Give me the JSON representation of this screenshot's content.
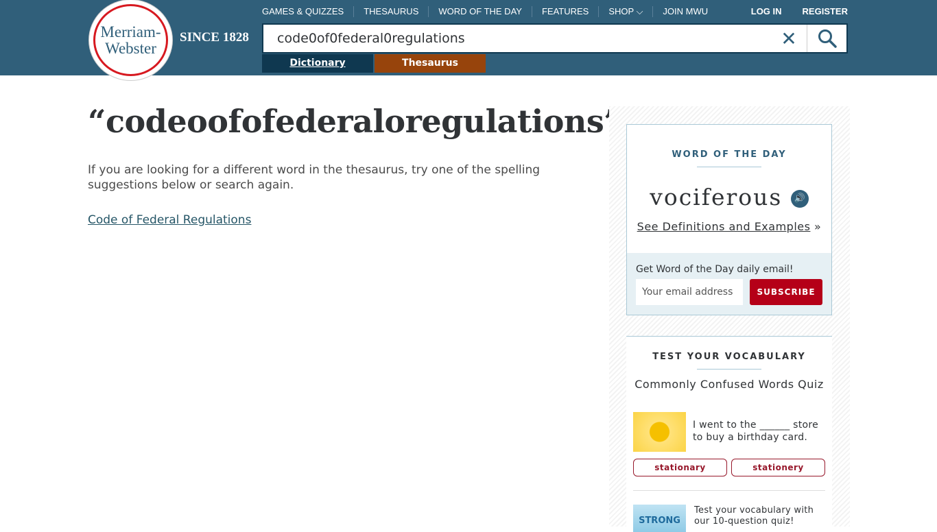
{
  "header": {
    "logo_line1": "Merriam-",
    "logo_line2": "Webster",
    "since": "SINCE 1828",
    "nav": [
      "GAMES & QUIZZES",
      "THESAURUS",
      "WORD OF THE DAY",
      "FEATURES",
      "SHOP ⌵",
      "JOIN MWU"
    ],
    "login": "LOG IN",
    "register": "REGISTER",
    "search_value": "code0of0federal0regulations",
    "tabs": {
      "dictionary": "Dictionary",
      "thesaurus": "Thesaurus"
    }
  },
  "main": {
    "title": "“codeoofofederaloregulations”",
    "message": "If you are looking for a different word in the thesaurus, try one of the spelling suggestions below or search again.",
    "suggestions": [
      "Code of Federal Regulations"
    ]
  },
  "wod": {
    "label": "WORD OF THE DAY",
    "word": "vociferous",
    "link": "See Definitions and Examples",
    "link_suffix": " »",
    "email_prompt": "Get Word of the Day daily email!",
    "email_placeholder": "Your email address",
    "subscribe": "SUBSCRIBE"
  },
  "vocab": {
    "label": "TEST YOUR VOCABULARY",
    "quiz_title": "Commonly Confused Words Quiz",
    "question": "I went to the ______ store to buy a birthday card.",
    "options": [
      "stationary",
      "stationery"
    ],
    "quiz2_image_text": "STRONG",
    "quiz2_text": "Test your vocabulary with our 10-question quiz!"
  },
  "colors": {
    "header": "#305f7a",
    "dictionary_tab": "#0f3850",
    "thesaurus_tab": "#97440c",
    "subscribe": "#b50018"
  }
}
